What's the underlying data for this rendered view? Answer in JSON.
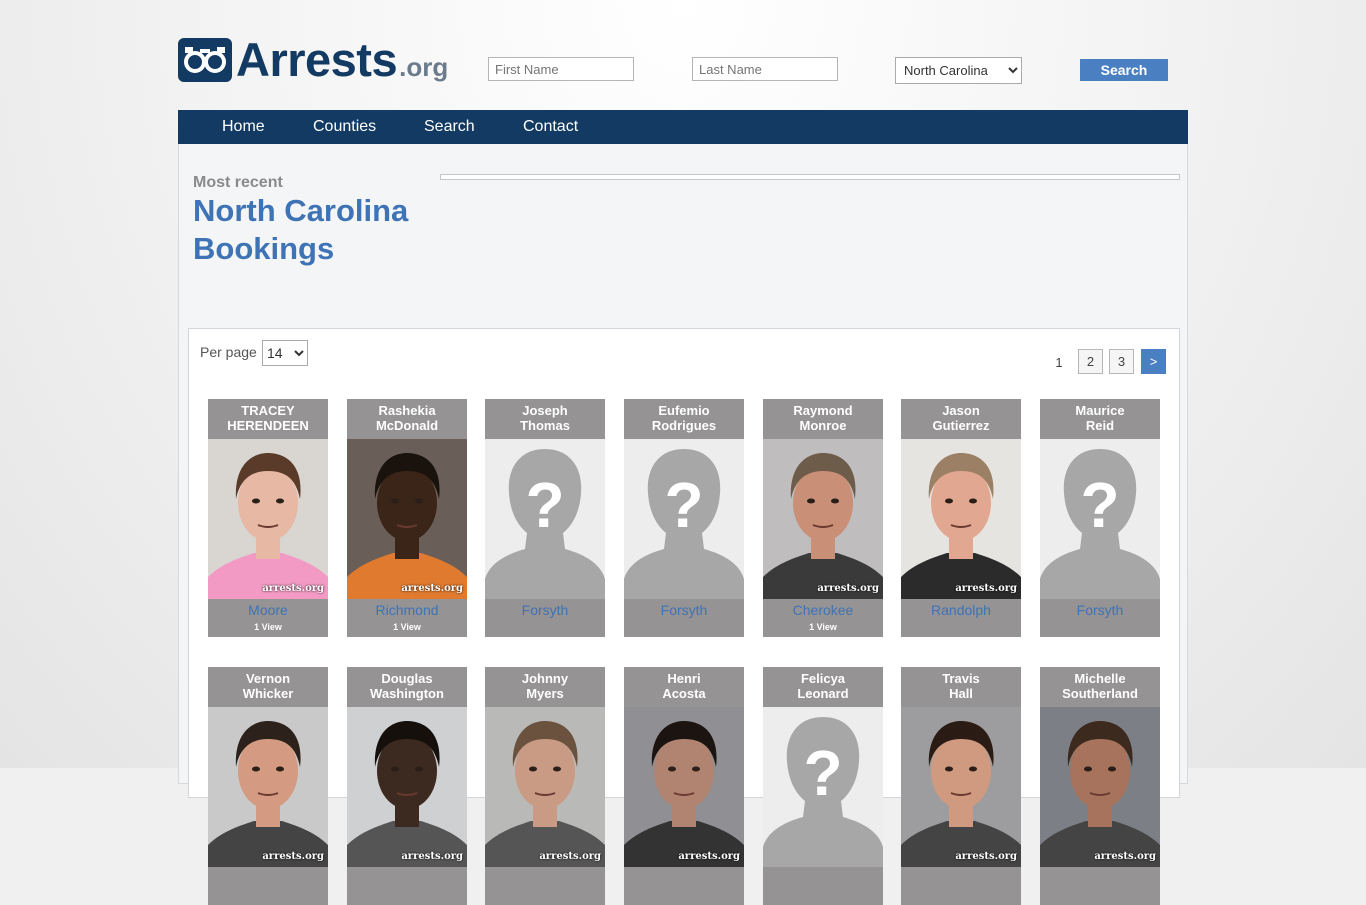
{
  "header": {
    "logo_text": "Arrests",
    "logo_suffix": ".org",
    "search": {
      "first_placeholder": "First Name",
      "last_placeholder": "Last Name",
      "state_value": "North Carolina",
      "button_label": "Search"
    }
  },
  "nav": {
    "items": [
      {
        "label": "Home"
      },
      {
        "label": "Counties"
      },
      {
        "label": "Search"
      },
      {
        "label": "Contact"
      }
    ]
  },
  "main": {
    "subtitle": "Most recent",
    "title": "North Carolina Bookings"
  },
  "list": {
    "per_page_label": "Per page",
    "per_page_value": "14",
    "pagination": {
      "current": "1",
      "pages": [
        "2",
        "3"
      ],
      "next_label": ">"
    },
    "watermark": "arrests.org",
    "cards": [
      {
        "first": "TRACEY",
        "last": "HERENDEEN",
        "county": "Moore",
        "views": "1 View",
        "photo": "photo",
        "skin": "#e7b8a4",
        "hair": "#5a3a28",
        "bg": "#d9d6d2",
        "shirt": "#f39ac4"
      },
      {
        "first": "Rashekia",
        "last": "McDonald",
        "county": "Richmond",
        "views": "1 View",
        "photo": "photo",
        "skin": "#3b2519",
        "hair": "#1a120c",
        "bg": "#6a5f58",
        "shirt": "#e07a2e"
      },
      {
        "first": "Joseph",
        "last": "Thomas",
        "county": "Forsyth",
        "views": "",
        "photo": "placeholder"
      },
      {
        "first": "Eufemio",
        "last": "Rodrigues",
        "county": "Forsyth",
        "views": "",
        "photo": "placeholder"
      },
      {
        "first": "Raymond",
        "last": "Monroe",
        "county": "Cherokee",
        "views": "1 View",
        "photo": "photo",
        "skin": "#c98f77",
        "hair": "#6e5c4a",
        "bg": "#bfbdbd",
        "shirt": "#3a3a3a"
      },
      {
        "first": "Jason",
        "last": "Gutierrez",
        "county": "Randolph",
        "views": "",
        "photo": "photo",
        "skin": "#e2a790",
        "hair": "#9c8065",
        "bg": "#e6e4e0",
        "shirt": "#2b2b2b"
      },
      {
        "first": "Maurice",
        "last": "Reid",
        "county": "Forsyth",
        "views": "",
        "photo": "placeholder"
      },
      {
        "first": "Vernon",
        "last": "Whicker",
        "county": "",
        "views": "",
        "photo": "photo",
        "skin": "#d49b82",
        "hair": "#2d221b",
        "bg": "#c9c9c9",
        "shirt": "#444444"
      },
      {
        "first": "Douglas",
        "last": "Washington",
        "county": "",
        "views": "",
        "photo": "photo",
        "skin": "#3c2a20",
        "hair": "#15100c",
        "bg": "#cfd0d2",
        "shirt": "#555555"
      },
      {
        "first": "Johnny",
        "last": "Myers",
        "county": "",
        "views": "",
        "photo": "photo",
        "skin": "#c99b84",
        "hair": "#6b523e",
        "bg": "#b9b9b8",
        "shirt": "#555555"
      },
      {
        "first": "Henri",
        "last": "Acosta",
        "county": "",
        "views": "",
        "photo": "photo",
        "skin": "#b08470",
        "hair": "#1b1411",
        "bg": "#8f8f94",
        "shirt": "#333333"
      },
      {
        "first": "Felicya",
        "last": "Leonard",
        "county": "",
        "views": "",
        "photo": "placeholder"
      },
      {
        "first": "Travis",
        "last": "Hall",
        "county": "",
        "views": "",
        "photo": "photo",
        "skin": "#d09a80",
        "hair": "#2a1c14",
        "bg": "#9d9d9f",
        "shirt": "#444444"
      },
      {
        "first": "Michelle",
        "last": "Southerland",
        "county": "",
        "views": "",
        "photo": "photo",
        "skin": "#a7735c",
        "hair": "#3c2a1e",
        "bg": "#7c7f86",
        "shirt": "#444444"
      }
    ]
  }
}
